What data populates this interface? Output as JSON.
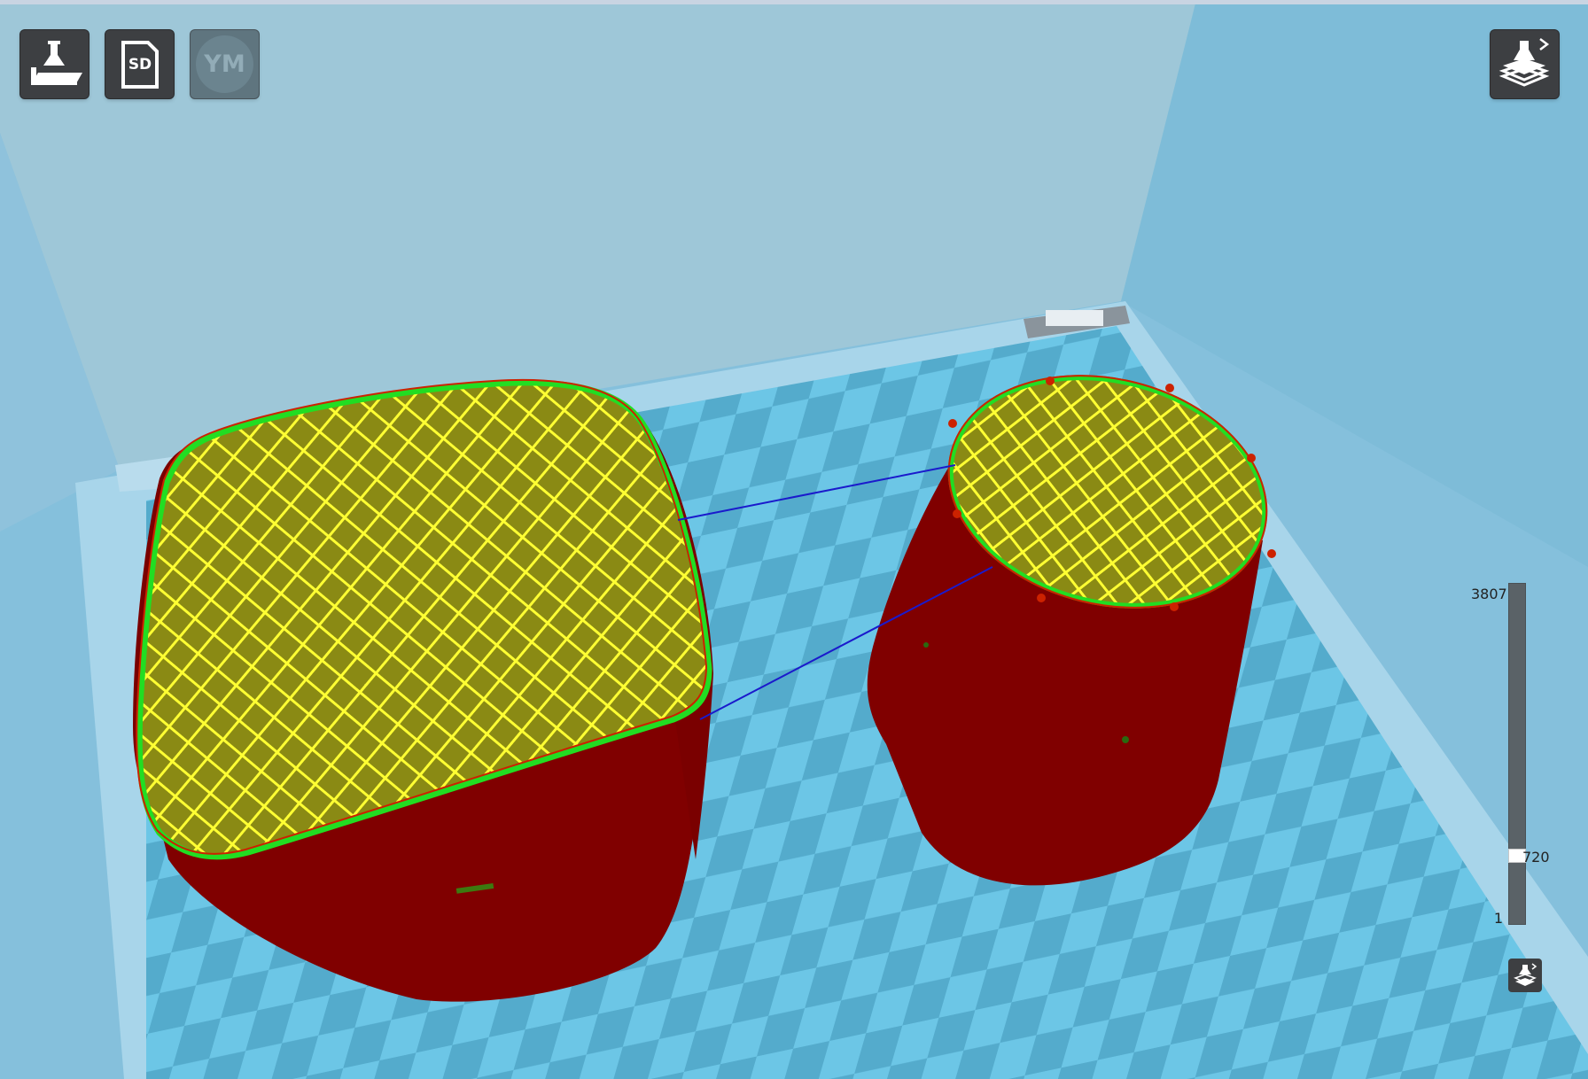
{
  "toolbar": {
    "load_icon": "load-model-icon",
    "sd_label": "SD",
    "ym_label": "YM"
  },
  "view_mode": {
    "icon": "layer-view-icon"
  },
  "layer_slider": {
    "max_label": "3807",
    "current_label": "720",
    "min_label": "1",
    "value": 720,
    "max": 3807,
    "min": 1
  },
  "colors": {
    "background": "#8fc3da",
    "model_wall": "#7f0000",
    "infill": "#ffff33",
    "outer_shell": "#22dd22",
    "travel_move": "#1a1acc",
    "button_bg": "#3d3f42"
  }
}
